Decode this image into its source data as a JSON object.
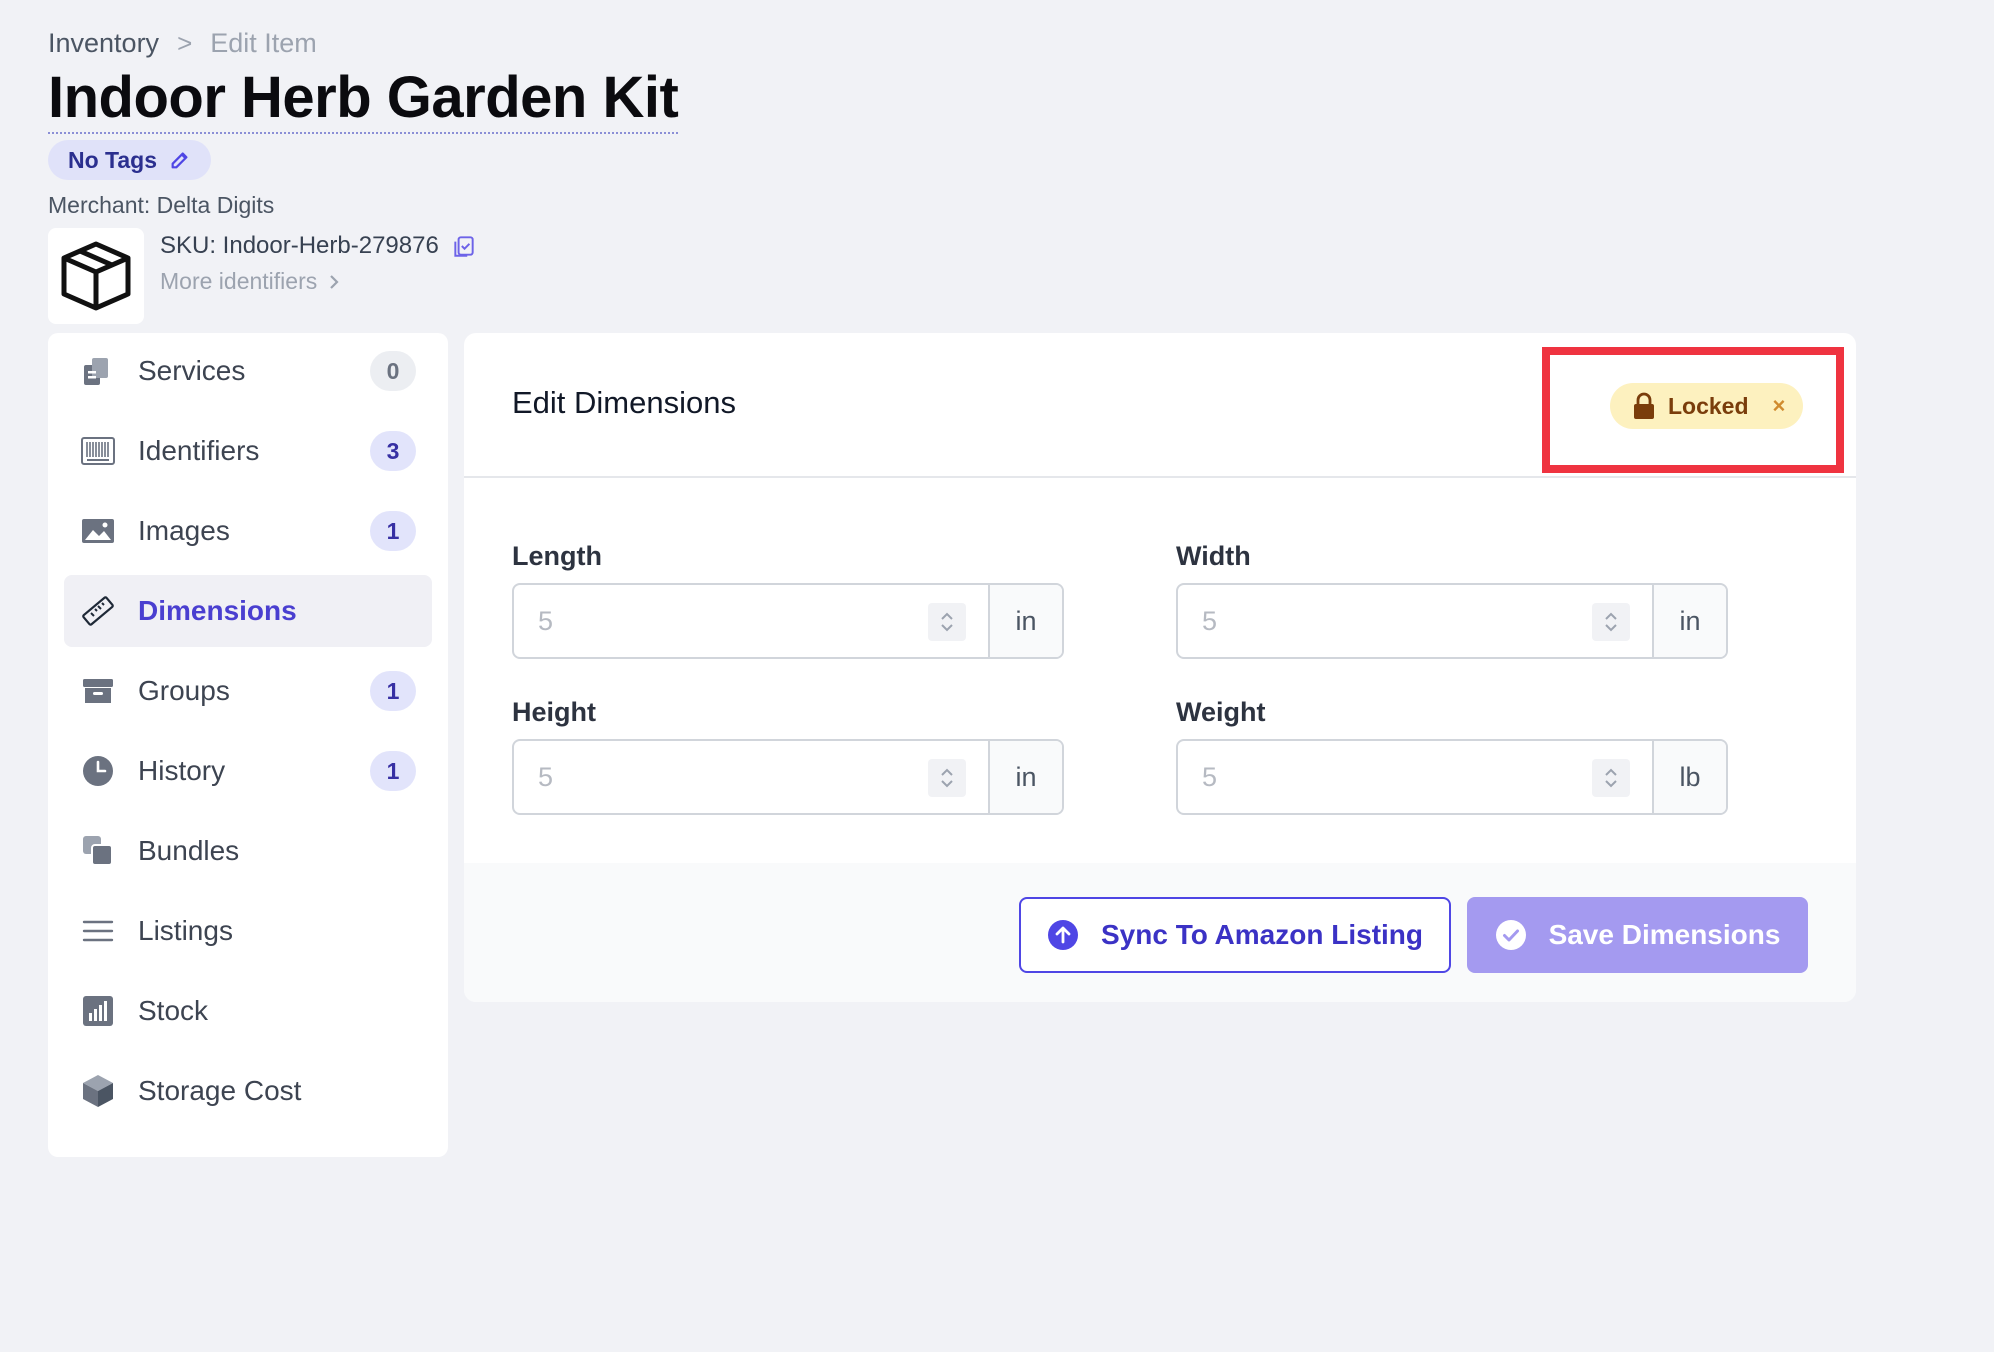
{
  "breadcrumb": {
    "parent": "Inventory",
    "separator": ">",
    "current": "Edit Item"
  },
  "item": {
    "title": "Indoor Herb Garden Kit",
    "tags_label": "No Tags",
    "merchant": "Merchant: Delta Digits",
    "sku": "SKU: Indoor-Herb-279876",
    "more_identifiers": "More identifiers"
  },
  "sidebar": {
    "items": [
      {
        "label": "Services",
        "count": "0",
        "icon": "services-icon"
      },
      {
        "label": "Identifiers",
        "count": "3",
        "icon": "barcode-icon"
      },
      {
        "label": "Images",
        "count": "1",
        "icon": "image-icon"
      },
      {
        "label": "Dimensions",
        "count": null,
        "icon": "ruler-icon",
        "active": true
      },
      {
        "label": "Groups",
        "count": "1",
        "icon": "archive-icon"
      },
      {
        "label": "History",
        "count": "1",
        "icon": "clock-icon"
      },
      {
        "label": "Bundles",
        "count": null,
        "icon": "bundles-icon"
      },
      {
        "label": "Listings",
        "count": null,
        "icon": "list-icon"
      },
      {
        "label": "Stock",
        "count": null,
        "icon": "chart-icon"
      },
      {
        "label": "Storage Cost",
        "count": null,
        "icon": "cube-icon"
      }
    ]
  },
  "editor": {
    "title": "Edit Dimensions",
    "lock_label": "Locked",
    "lock_close": "×",
    "fields": {
      "length": {
        "label": "Length",
        "value": "5",
        "unit": "in"
      },
      "width": {
        "label": "Width",
        "value": "5",
        "unit": "in"
      },
      "height": {
        "label": "Height",
        "value": "5",
        "unit": "in"
      },
      "weight": {
        "label": "Weight",
        "value": "5",
        "unit": "lb"
      }
    },
    "sync_label": "Sync To Amazon Listing",
    "save_label": "Save Dimensions"
  },
  "colors": {
    "accent": "#4f46e5",
    "save_disabled": "#a49af0",
    "lock_badge_bg": "#fdf1bf",
    "highlight": "#ef3340"
  }
}
